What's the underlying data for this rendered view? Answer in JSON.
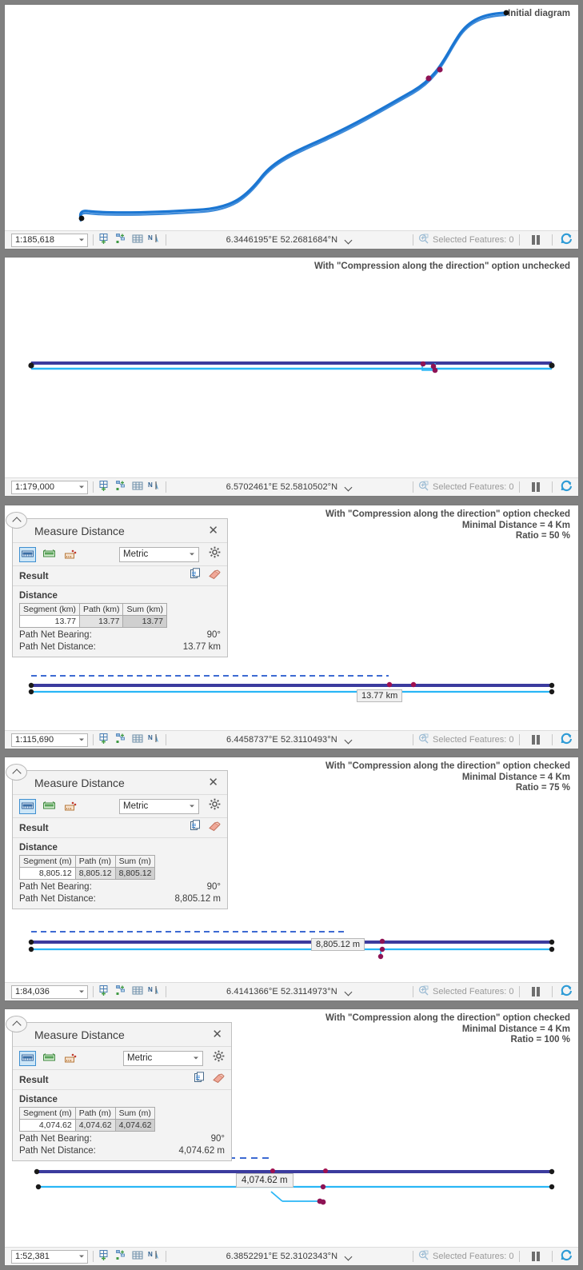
{
  "panels": [
    {
      "title": "Initial diagram",
      "status": {
        "scale": "1:185,618",
        "coords": "6.3446195°E 52.2681684°N",
        "selected_features": "Selected Features: 0"
      }
    },
    {
      "title": "With \"Compression along the direction\" option unchecked",
      "status": {
        "scale": "1:179,000",
        "coords": "6.5702461°E 52.5810502°N",
        "selected_features": "Selected Features: 0"
      }
    },
    {
      "title": "With \"Compression along the direction\" option checked\nMinimal Distance = 4 Km\nRatio = 50 %",
      "status": {
        "scale": "1:115,690",
        "coords": "6.4458737°E 52.3110493°N",
        "selected_features": "Selected Features: 0"
      },
      "dialog": {
        "title": "Measure Distance",
        "close_label": "✕",
        "unit": "Metric",
        "result_label": "Result",
        "distance_label": "Distance",
        "columns": [
          "Segment (km)",
          "Path (km)",
          "Sum (km)"
        ],
        "row": [
          "13.77",
          "13.77",
          "13.77"
        ],
        "bearing_label": "Path Net Bearing:",
        "bearing_value": "90°",
        "net_distance_label": "Path Net Distance:",
        "net_distance_value": "13.77 km"
      },
      "measure_tooltip": "13.77 km"
    },
    {
      "title": "With \"Compression along the direction\" option checked\nMinimal Distance = 4 Km\nRatio = 75 %",
      "status": {
        "scale": "1:84,036",
        "coords": "6.4141366°E 52.3114973°N",
        "selected_features": "Selected Features: 0"
      },
      "dialog": {
        "title": "Measure Distance",
        "close_label": "✕",
        "unit": "Metric",
        "result_label": "Result",
        "distance_label": "Distance",
        "columns": [
          "Segment (m)",
          "Path (m)",
          "Sum (m)"
        ],
        "row": [
          "8,805.12",
          "8,805.12",
          "8,805.12"
        ],
        "bearing_label": "Path Net Bearing:",
        "bearing_value": "90°",
        "net_distance_label": "Path Net Distance:",
        "net_distance_value": "8,805.12 m"
      },
      "measure_tooltip": "8,805.12 m"
    },
    {
      "title": "With \"Compression along the direction\" option checked\nMinimal Distance = 4 Km\nRatio = 100 %",
      "status": {
        "scale": "1:52,381",
        "coords": "6.3852291°E 52.3102343°N",
        "selected_features": "Selected Features: 0"
      },
      "dialog": {
        "title": "Measure Distance",
        "close_label": "✕",
        "unit": "Metric",
        "result_label": "Result",
        "distance_label": "Distance",
        "columns": [
          "Segment (m)",
          "Path (m)",
          "Sum (m)"
        ],
        "row": [
          "4,074.62",
          "4,074.62",
          "4,074.62"
        ],
        "bearing_label": "Path Net Bearing:",
        "bearing_value": "90°",
        "net_distance_label": "Path Net Distance:",
        "net_distance_value": "4,074.62 m"
      },
      "measure_tooltip": "4,074.62 m"
    }
  ],
  "colors": {
    "route_blue": "#1b76d2",
    "dark_blue": "#3b3b9e",
    "cyan": "#29b6f6",
    "junction_purple": "#8e1355",
    "accent": "#2e9bd6",
    "panel_bg": "#f3f3f3"
  },
  "icons": {
    "layout_add": "new-layout-icon",
    "diagram_add": "add-diagram-icon",
    "grid": "grid-icon",
    "north": "north-arrow-icon",
    "zoom_selected": "zoom-to-selected-icon",
    "pause": "pause-icon",
    "refresh": "refresh-icon",
    "measure_distance": "measure-distance-icon",
    "measure_area": "measure-area-icon",
    "measure_feature": "measure-feature-icon",
    "gear": "gear-icon",
    "copy": "copy-icon",
    "eraser": "eraser-icon",
    "collapse": "collapse-chevron-icon"
  }
}
